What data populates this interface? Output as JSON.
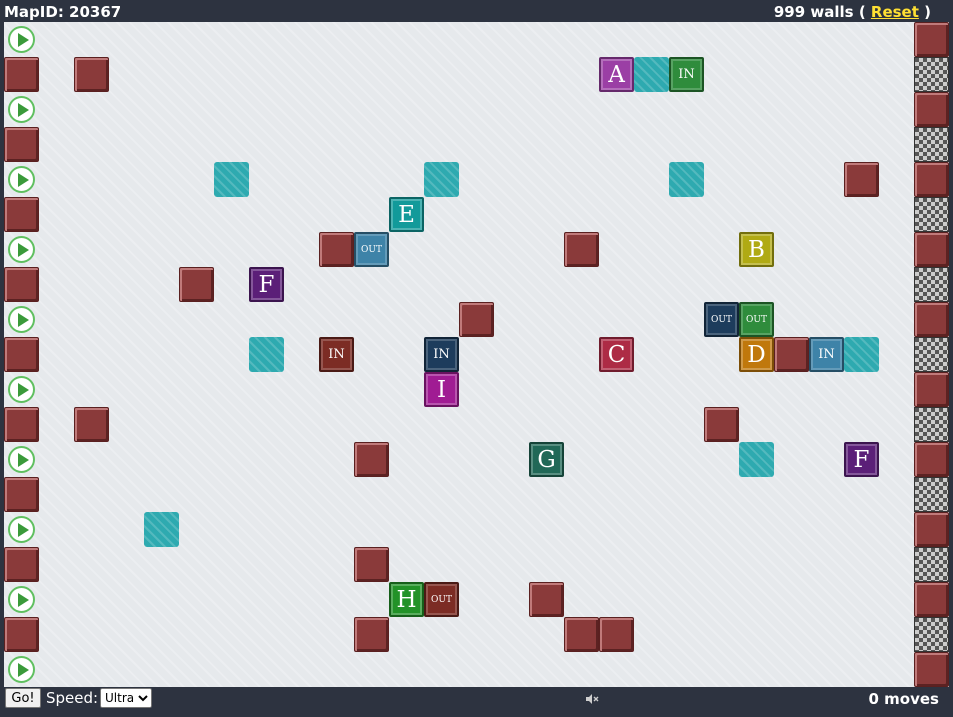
{
  "header": {
    "map_id_text": "MapID: 20367",
    "walls_text": "999 walls",
    "open_paren": "(",
    "reset_label": "Reset",
    "close_paren": ")"
  },
  "colors": {
    "wall": "#8a3a3a",
    "teal": "#2eaab0",
    "A": "#9b3fa5",
    "B": "#b0aa14",
    "C": "#ad2b45",
    "D": "#c0780c",
    "E": "#129a9a",
    "F": "#5b1f78",
    "G": "#216857",
    "H": "#229228",
    "I": "#a01c93",
    "in_green": "#2f8c3c",
    "in_brown": "#7c2c24",
    "in_navy": "#1d3c5c",
    "in_blue": "#3e83a8",
    "out_blue": "#3e83a8",
    "out_navy": "#1d3c5c",
    "out_green": "#2f8c3c",
    "out_brown": "#7c2c24"
  },
  "board": {
    "cols": 27,
    "rows": 19,
    "left_column": [
      "play",
      "wall",
      "play",
      "wall",
      "play",
      "wall",
      "play",
      "wall",
      "play",
      "wall",
      "play",
      "wall",
      "play",
      "wall",
      "play",
      "wall",
      "play",
      "wall",
      "play"
    ],
    "right_column": [
      "wall",
      "checker",
      "wall",
      "checker",
      "wall",
      "checker",
      "wall",
      "checker",
      "wall",
      "checker",
      "wall",
      "checker",
      "wall",
      "checker",
      "wall",
      "checker",
      "wall",
      "checker",
      "wall"
    ],
    "walls": [
      [
        2,
        1
      ],
      [
        24,
        4
      ],
      [
        9,
        6
      ],
      [
        16,
        6
      ],
      [
        5,
        7
      ],
      [
        13,
        8
      ],
      [
        22,
        9
      ],
      [
        2,
        11
      ],
      [
        20,
        11
      ],
      [
        10,
        12
      ],
      [
        10,
        15
      ],
      [
        15,
        16
      ],
      [
        10,
        17
      ],
      [
        16,
        17
      ],
      [
        17,
        17
      ]
    ],
    "teal_tiles": [
      [
        18,
        1
      ],
      [
        6,
        4
      ],
      [
        12,
        4
      ],
      [
        19,
        4
      ],
      [
        7,
        9
      ],
      [
        24,
        9
      ],
      [
        21,
        12
      ],
      [
        4,
        14
      ]
    ],
    "letters": [
      {
        "col": 17,
        "row": 1,
        "text": "A",
        "color": "A"
      },
      {
        "col": 11,
        "row": 5,
        "text": "E",
        "color": "E"
      },
      {
        "col": 21,
        "row": 6,
        "text": "B",
        "color": "B"
      },
      {
        "col": 7,
        "row": 7,
        "text": "F",
        "color": "F"
      },
      {
        "col": 17,
        "row": 9,
        "text": "C",
        "color": "C"
      },
      {
        "col": 21,
        "row": 9,
        "text": "D",
        "color": "D"
      },
      {
        "col": 12,
        "row": 10,
        "text": "I",
        "color": "I"
      },
      {
        "col": 15,
        "row": 12,
        "text": "G",
        "color": "G"
      },
      {
        "col": 24,
        "row": 12,
        "text": "F",
        "color": "F"
      },
      {
        "col": 11,
        "row": 16,
        "text": "H",
        "color": "H"
      }
    ],
    "portals": [
      {
        "col": 19,
        "row": 1,
        "text": "IN",
        "kind": "in",
        "color": "in_green"
      },
      {
        "col": 10,
        "row": 6,
        "text": "OUT",
        "kind": "out",
        "color": "out_blue"
      },
      {
        "col": 20,
        "row": 8,
        "text": "OUT",
        "kind": "out",
        "color": "out_navy"
      },
      {
        "col": 21,
        "row": 8,
        "text": "OUT",
        "kind": "out",
        "color": "out_green"
      },
      {
        "col": 9,
        "row": 9,
        "text": "IN",
        "kind": "in",
        "color": "in_brown"
      },
      {
        "col": 12,
        "row": 9,
        "text": "IN",
        "kind": "in",
        "color": "in_navy"
      },
      {
        "col": 23,
        "row": 9,
        "text": "IN",
        "kind": "in",
        "color": "in_blue"
      },
      {
        "col": 12,
        "row": 16,
        "text": "OUT",
        "kind": "out",
        "color": "out_brown"
      }
    ]
  },
  "footer": {
    "go_label": "Go!",
    "speed_label": "Speed:",
    "speed_value": "Ultra",
    "speed_options": [
      "Ultra"
    ],
    "moves_text": "0 moves",
    "sound_icon": "speaker-muted-icon"
  }
}
